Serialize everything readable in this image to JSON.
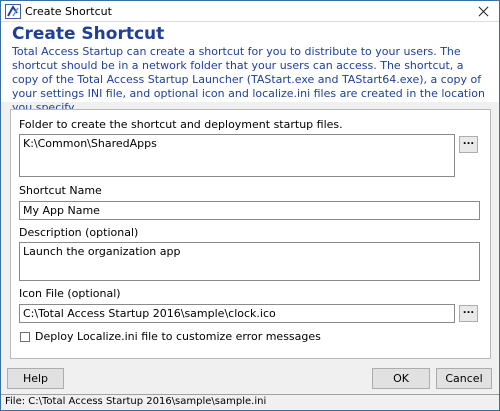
{
  "window": {
    "title": "Create Shortcut"
  },
  "header": {
    "heading": "Create Shortcut",
    "description": "Total Access Startup can create a shortcut for you to distribute to your users. The shortcut should be in a network folder that your users can access. The shortcut, a copy of the Total Access Startup Launcher (TAStart.exe and TAStart64.exe), a copy of your settings INI file, and optional icon and localize.ini files are created in the location you specify."
  },
  "form": {
    "folder": {
      "label": "Folder to create the shortcut and deployment startup files.",
      "value": "K:\\Common\\SharedApps"
    },
    "shortcut_name": {
      "label": "Shortcut Name",
      "value": "My App Name"
    },
    "description": {
      "label": "Description (optional)",
      "value": "Launch the organization app"
    },
    "icon_file": {
      "label": "Icon File (optional)",
      "value": "C:\\Total Access Startup 2016\\sample\\clock.ico"
    },
    "browse_label": "...",
    "localize_checkbox": {
      "label": "Deploy Localize.ini file to customize error messages",
      "checked": false
    }
  },
  "buttons": {
    "help": "Help",
    "ok": "OK",
    "cancel": "Cancel"
  },
  "status": {
    "text": "File: C:\\Total Access Startup 2016\\sample\\sample.ini"
  }
}
